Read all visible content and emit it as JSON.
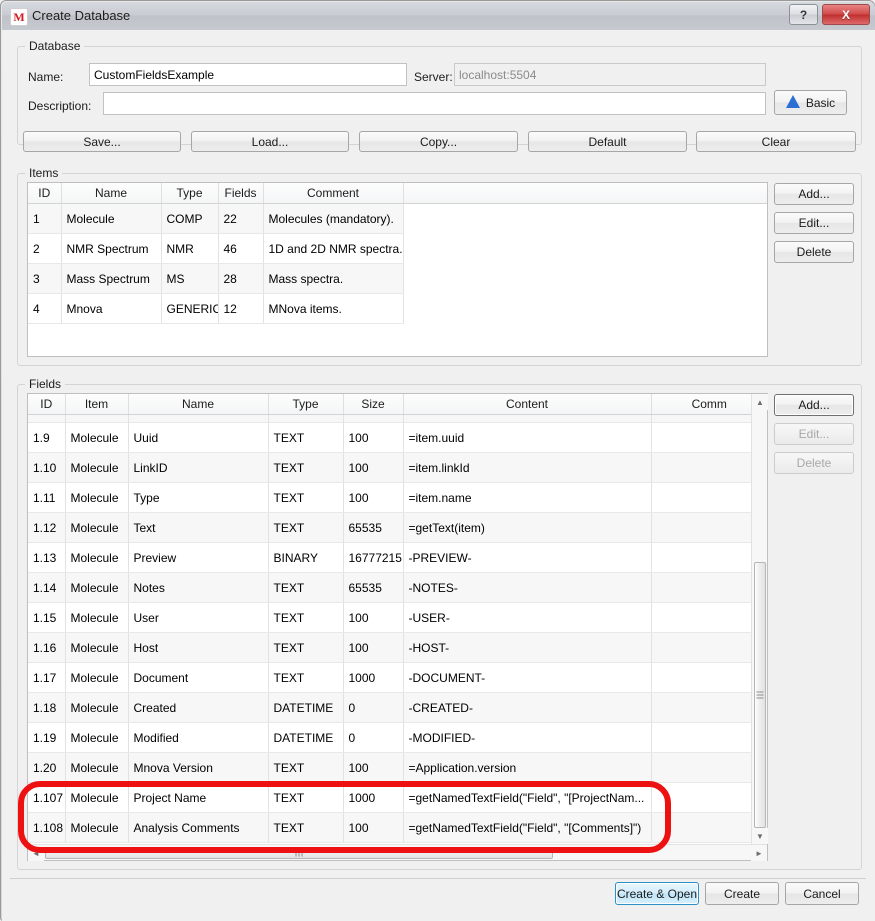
{
  "window": {
    "title": "Create Database",
    "app_icon_glyph": "M",
    "ghost_title": "",
    "help_label": "?",
    "close_label": "X"
  },
  "database_group": {
    "legend": "Database",
    "name_label": "Name:",
    "name_value": "CustomFieldsExample",
    "server_label": "Server:",
    "server_value": "localhost:5504",
    "description_label": "Description:",
    "description_value": "",
    "basic_button": "Basic"
  },
  "toolbar": {
    "save": "Save...",
    "load": "Load...",
    "copy": "Copy...",
    "default": "Default",
    "clear": "Clear"
  },
  "items_group": {
    "legend": "Items",
    "columns": [
      "ID",
      "Name",
      "Type",
      "Fields",
      "Comment",
      ""
    ],
    "rows": [
      {
        "id": "1",
        "name": "Molecule",
        "type": "COMP",
        "fields": "22",
        "comment": "Molecules (mandatory)."
      },
      {
        "id": "2",
        "name": "NMR Spectrum",
        "type": "NMR",
        "fields": "46",
        "comment": "1D and 2D NMR spectra."
      },
      {
        "id": "3",
        "name": "Mass Spectrum",
        "type": "MS",
        "fields": "28",
        "comment": "Mass spectra."
      },
      {
        "id": "4",
        "name": "Mnova",
        "type": "GENERIC",
        "fields": "12",
        "comment": "MNova items."
      }
    ],
    "buttons": {
      "add": "Add...",
      "edit": "Edit...",
      "delete": "Delete"
    }
  },
  "fields_group": {
    "legend": "Fields",
    "columns": [
      "ID",
      "Item",
      "Name",
      "Type",
      "Size",
      "Content",
      "Comm"
    ],
    "rows": [
      {
        "id": "1.9",
        "item": "Molecule",
        "name": "Uuid",
        "type": "TEXT",
        "size": "100",
        "content": "=item.uuid",
        "comment": ""
      },
      {
        "id": "1.10",
        "item": "Molecule",
        "name": "LinkID",
        "type": "TEXT",
        "size": "100",
        "content": "=item.linkId",
        "comment": ""
      },
      {
        "id": "1.11",
        "item": "Molecule",
        "name": "Type",
        "type": "TEXT",
        "size": "100",
        "content": "=item.name",
        "comment": ""
      },
      {
        "id": "1.12",
        "item": "Molecule",
        "name": "Text",
        "type": "TEXT",
        "size": "65535",
        "content": "=getText(item)",
        "comment": ""
      },
      {
        "id": "1.13",
        "item": "Molecule",
        "name": "Preview",
        "type": "BINARY",
        "size": "16777215",
        "content": "-PREVIEW-",
        "comment": ""
      },
      {
        "id": "1.14",
        "item": "Molecule",
        "name": "Notes",
        "type": "TEXT",
        "size": "65535",
        "content": "-NOTES-",
        "comment": ""
      },
      {
        "id": "1.15",
        "item": "Molecule",
        "name": "User",
        "type": "TEXT",
        "size": "100",
        "content": "-USER-",
        "comment": ""
      },
      {
        "id": "1.16",
        "item": "Molecule",
        "name": "Host",
        "type": "TEXT",
        "size": "100",
        "content": "-HOST-",
        "comment": ""
      },
      {
        "id": "1.17",
        "item": "Molecule",
        "name": "Document",
        "type": "TEXT",
        "size": "1000",
        "content": "-DOCUMENT-",
        "comment": ""
      },
      {
        "id": "1.18",
        "item": "Molecule",
        "name": "Created",
        "type": "DATETIME",
        "size": "0",
        "content": "-CREATED-",
        "comment": ""
      },
      {
        "id": "1.19",
        "item": "Molecule",
        "name": "Modified",
        "type": "DATETIME",
        "size": "0",
        "content": "-MODIFIED-",
        "comment": ""
      },
      {
        "id": "1.20",
        "item": "Molecule",
        "name": "Mnova Version",
        "type": "TEXT",
        "size": "100",
        "content": "=Application.version",
        "comment": ""
      },
      {
        "id": "1.107",
        "item": "Molecule",
        "name": "Project Name",
        "type": "TEXT",
        "size": "1000",
        "content": "=getNamedTextField(\"Field\", \"[ProjectNam...",
        "comment": ""
      },
      {
        "id": "1.108",
        "item": "Molecule",
        "name": "Analysis Comments",
        "type": "TEXT",
        "size": "100",
        "content": "=getNamedTextField(\"Field\", \"[Comments]\")",
        "comment": ""
      }
    ],
    "buttons": {
      "add": "Add...",
      "edit": "Edit...",
      "delete": "Delete"
    }
  },
  "footer": {
    "create_and_open": "Create & Open",
    "create": "Create",
    "cancel": "Cancel"
  },
  "icons": {
    "scroll_up": "▲",
    "scroll_down": "▼",
    "scroll_left": "◄",
    "scroll_right": "►"
  },
  "colors": {
    "accent": "#2d8fc4",
    "annotation": "#ee1111",
    "close": "#bf2f2f"
  }
}
